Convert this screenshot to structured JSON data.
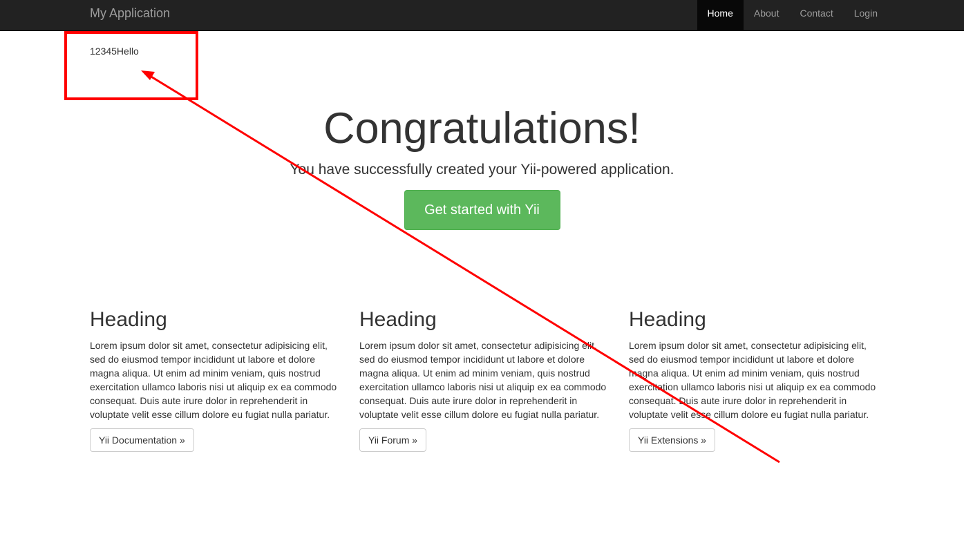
{
  "navbar": {
    "brand": "My Application",
    "items": [
      {
        "label": "Home",
        "active": true
      },
      {
        "label": "About",
        "active": false
      },
      {
        "label": "Contact",
        "active": false
      },
      {
        "label": "Login",
        "active": false
      }
    ]
  },
  "note_text": "12345Hello",
  "jumbotron": {
    "title": "Congratulations!",
    "lead": "You have successfully created your Yii-powered application.",
    "button_label": "Get started with Yii"
  },
  "columns": [
    {
      "heading": "Heading",
      "text": "Lorem ipsum dolor sit amet, consectetur adipisicing elit, sed do eiusmod tempor incididunt ut labore et dolore magna aliqua. Ut enim ad minim veniam, quis nostrud exercitation ullamco laboris nisi ut aliquip ex ea commodo consequat. Duis aute irure dolor in reprehenderit in voluptate velit esse cillum dolore eu fugiat nulla pariatur.",
      "button_label": "Yii Documentation »"
    },
    {
      "heading": "Heading",
      "text": "Lorem ipsum dolor sit amet, consectetur adipisicing elit, sed do eiusmod tempor incididunt ut labore et dolore magna aliqua. Ut enim ad minim veniam, quis nostrud exercitation ullamco laboris nisi ut aliquip ex ea commodo consequat. Duis aute irure dolor in reprehenderit in voluptate velit esse cillum dolore eu fugiat nulla pariatur.",
      "button_label": "Yii Forum »"
    },
    {
      "heading": "Heading",
      "text": "Lorem ipsum dolor sit amet, consectetur adipisicing elit, sed do eiusmod tempor incididunt ut labore et dolore magna aliqua. Ut enim ad minim veniam, quis nostrud exercitation ullamco laboris nisi ut aliquip ex ea commodo consequat. Duis aute irure dolor in reprehenderit in voluptate velit esse cillum dolore eu fugiat nulla pariatur.",
      "button_label": "Yii Extensions »"
    }
  ],
  "colors": {
    "navbar_bg": "#222222",
    "success": "#5cb85c",
    "annotation": "#ff0000"
  }
}
